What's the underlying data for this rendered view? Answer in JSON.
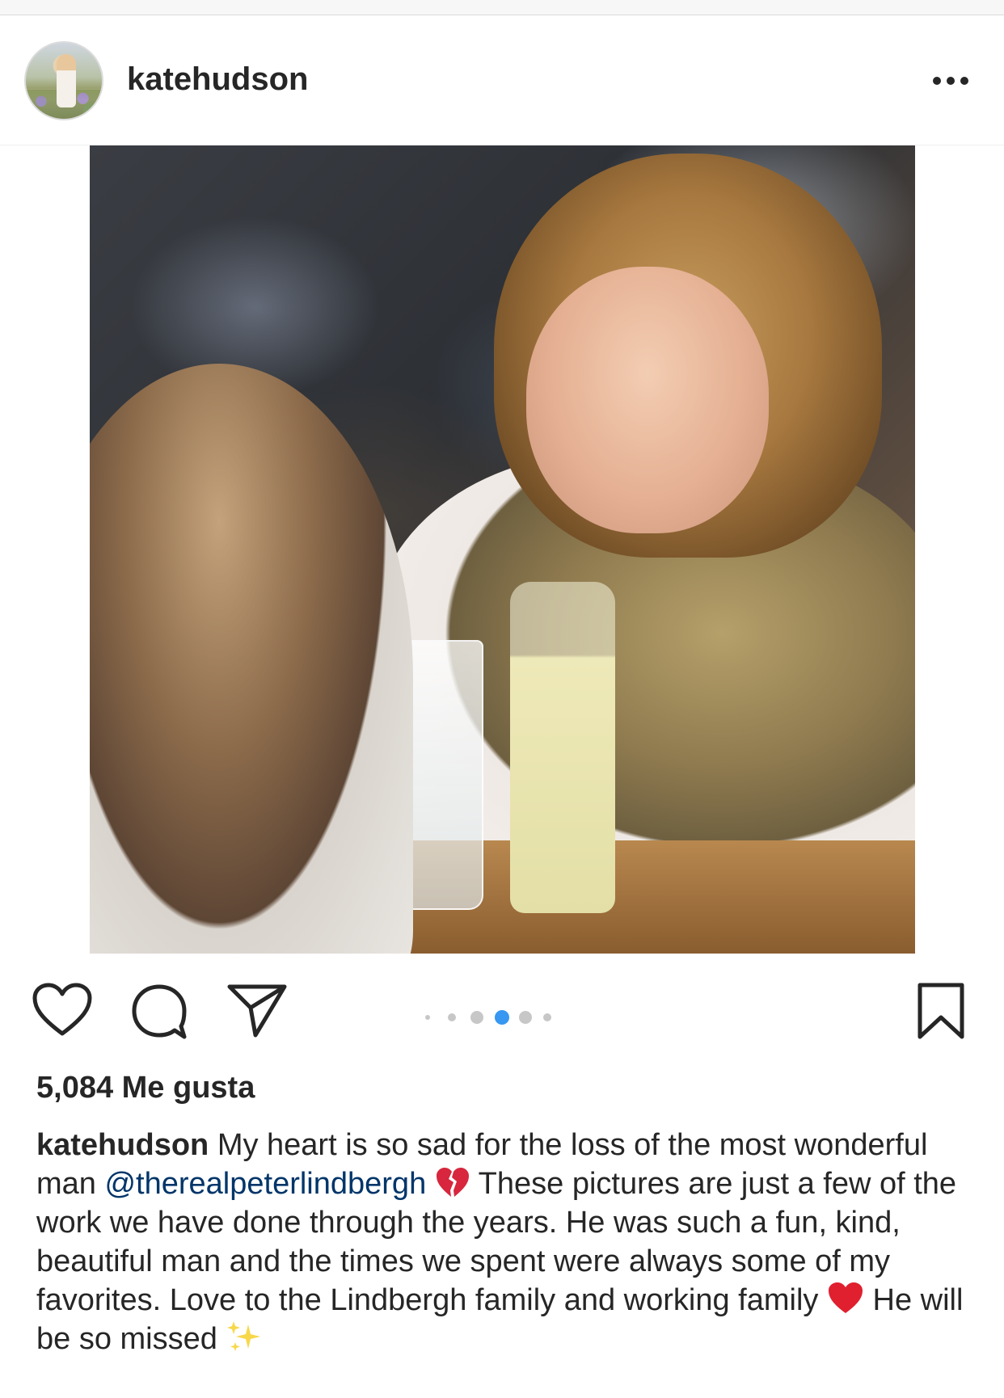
{
  "post": {
    "username": "katehudson",
    "likes_text": "5,084 Me gusta",
    "caption": {
      "author": "katehudson",
      "part1": "My heart is so sad for the loss of the most wonderful man",
      "mention": "@therealpeterlindbergh",
      "part2": "These pictures are just a few of the work we have done through the years. He was such a fun, kind, beautiful man and the times we spent were always some of my favorites. Love to the Lindbergh family and working family",
      "part3": "He will be so missed"
    },
    "carousel": {
      "count": 6,
      "active_index": 3
    }
  },
  "icons": {
    "more": "more-horizontal-icon",
    "like": "heart-outline-icon",
    "comment": "comment-bubble-icon",
    "share": "paper-plane-icon",
    "save": "bookmark-outline-icon",
    "broken_heart": "broken-heart-emoji",
    "red_heart": "red-heart-emoji",
    "sparkles": "sparkles-emoji"
  },
  "colors": {
    "text": "#262626",
    "mention": "#003569",
    "active_dot": "#3897f0"
  }
}
